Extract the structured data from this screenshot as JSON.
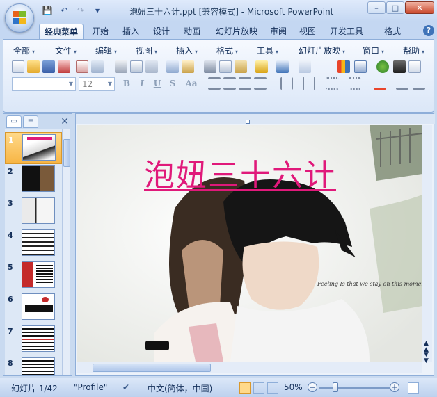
{
  "window": {
    "title": "泡妞三十六计.ppt [兼容模式] - Microsoft PowerPoint",
    "buttons": {
      "minimize": "–",
      "maximize": "□",
      "close": "✕"
    }
  },
  "quick_access": {
    "save": "💾",
    "undo": "↶",
    "redo": "↷",
    "customize": "▾"
  },
  "tabs": [
    {
      "label": "经典菜单",
      "active": true
    },
    {
      "label": "开始"
    },
    {
      "label": "插入"
    },
    {
      "label": "设计"
    },
    {
      "label": "动画"
    },
    {
      "label": "幻灯片放映"
    },
    {
      "label": "审阅"
    },
    {
      "label": "视图"
    },
    {
      "label": "开发工具"
    },
    {
      "label": "格式"
    }
  ],
  "help": "?",
  "menus": [
    "全部",
    "文件",
    "编辑",
    "视图",
    "插入",
    "格式",
    "工具",
    "幻灯片放映",
    "窗口",
    "帮助"
  ],
  "format_bar": {
    "font_value": "",
    "size_value": "12",
    "bold": "B",
    "italic": "I",
    "underline": "U",
    "strike": "S",
    "case": "Aa"
  },
  "panel": {
    "close": "✕"
  },
  "slides": [
    {
      "num": "1",
      "selected": true
    },
    {
      "num": "2"
    },
    {
      "num": "3"
    },
    {
      "num": "4"
    },
    {
      "num": "5"
    },
    {
      "num": "6"
    },
    {
      "num": "7"
    },
    {
      "num": "8"
    }
  ],
  "slide": {
    "title": "泡妞三十六计",
    "caption": "Feeling Is that we stay on this moment"
  },
  "status": {
    "slide_counter": "幻灯片 1/42",
    "theme": "\"Profile\"",
    "language": "中文(简体，中国)",
    "zoom": "50%"
  },
  "colors": {
    "accent": "#e0197a",
    "ribbon": "#dbe7f8"
  }
}
